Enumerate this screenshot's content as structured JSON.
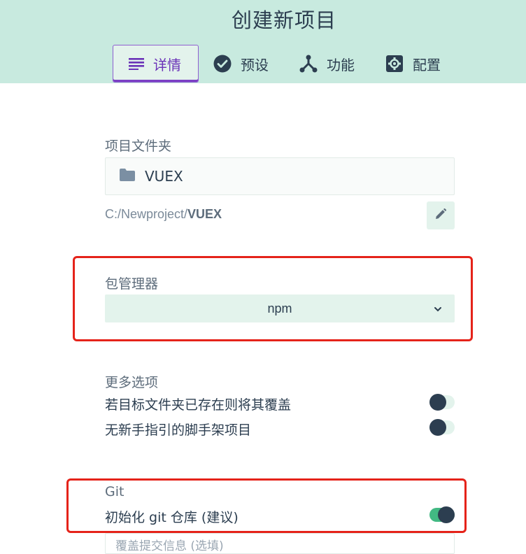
{
  "header": {
    "title": "创建新项目",
    "tabs": [
      {
        "label": "详情",
        "icon": "list-icon",
        "active": true
      },
      {
        "label": "预设",
        "icon": "check-circle-icon",
        "active": false
      },
      {
        "label": "功能",
        "icon": "fork-icon",
        "active": false
      },
      {
        "label": "配置",
        "icon": "gear-icon",
        "active": false
      }
    ]
  },
  "folder": {
    "label": "项目文件夹",
    "name": "VUEX",
    "icon": "folder-icon",
    "path_prefix": "C:/Newproject/",
    "path_name": "VUEX",
    "edit_icon": "pencil-icon"
  },
  "package_manager": {
    "label": "包管理器",
    "selected": "npm",
    "icon": "chevron-down-icon"
  },
  "more_options": {
    "label": "更多选项",
    "options": [
      {
        "label": "若目标文件夹已存在则将其覆盖",
        "enabled": false
      },
      {
        "label": "无新手指引的脚手架项目",
        "enabled": false
      }
    ]
  },
  "git": {
    "label": "Git",
    "init_label": "初始化 git 仓库 (建议)",
    "init_enabled": true,
    "commit_placeholder": "覆盖提交信息 (选填)"
  },
  "colors": {
    "header_bg": "#c8eadf",
    "active_tab": "#7b3fc4",
    "text": "#2c3e50",
    "accent_green": "#42b983",
    "annotation_red": "#e5231a"
  }
}
